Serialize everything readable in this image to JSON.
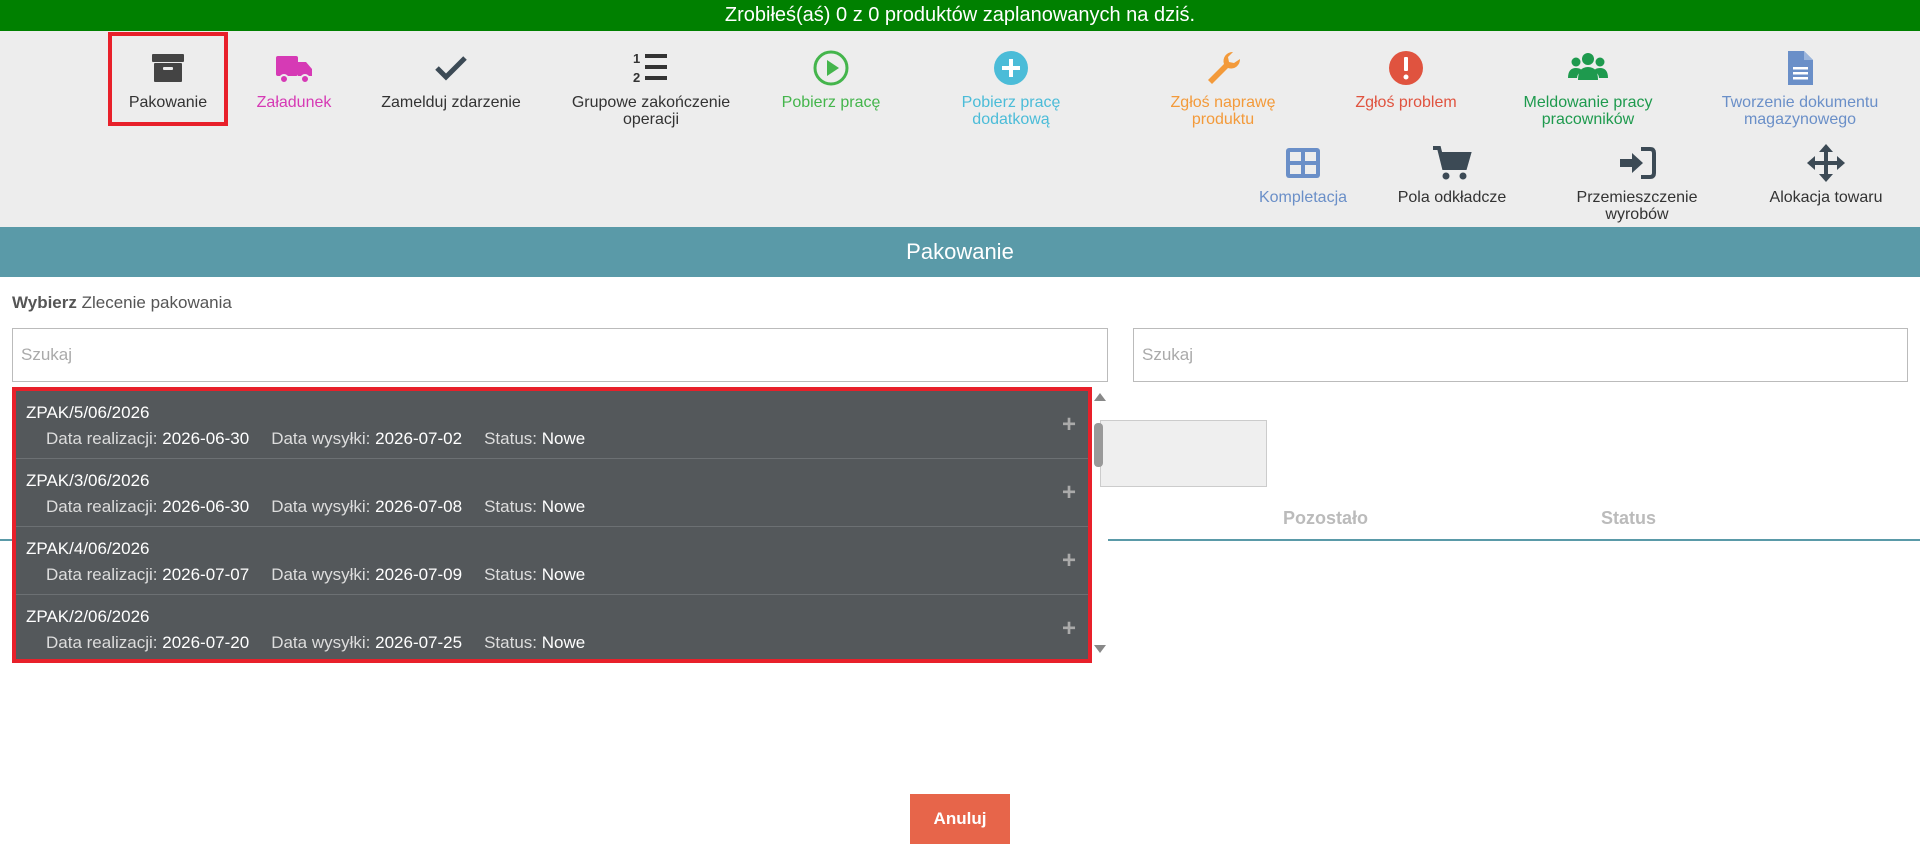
{
  "banner": {
    "text": "Zrobiłeś(aś) 0 z 0 produktów zaplanowanych na dziś."
  },
  "toolbar": {
    "items": [
      {
        "label": "Pakowanie",
        "color": "#333333"
      },
      {
        "label": "Załadunek",
        "color": "#d63ab5"
      },
      {
        "label": "Zamelduj zdarzenie",
        "color": "#333333"
      },
      {
        "label": "Grupowe zakończenie operacji",
        "color": "#333333"
      },
      {
        "label": "Pobierz pracę",
        "color": "#44b54c"
      },
      {
        "label": "Pobierz pracę dodatkową",
        "color": "#4bbcd8"
      },
      {
        "label": "Zgłoś naprawę produktu",
        "color": "#f39a3a"
      },
      {
        "label": "Zgłoś problem",
        "color": "#e0533f"
      },
      {
        "label": "Meldowanie pracy pracowników",
        "color": "#1e9a4e"
      },
      {
        "label": "Tworzenie dokumentu magazynowego",
        "color": "#6a8fc8"
      },
      {
        "label": "Kompletacja",
        "color": "#6a8fc8"
      },
      {
        "label": "Pola odkładcze",
        "color": "#333333"
      },
      {
        "label": "Przemieszczenie wyrobów",
        "color": "#333333"
      },
      {
        "label": "Alokacja towaru",
        "color": "#333333"
      }
    ]
  },
  "section": {
    "title": "Pakowanie"
  },
  "select": {
    "bold": "Wybierz",
    "rest": "Zlecenie pakowania"
  },
  "search_left": {
    "placeholder": "Szukaj",
    "value": ""
  },
  "search_right": {
    "placeholder": "Szukaj",
    "value": ""
  },
  "table": {
    "col_remaining": "Pozostało",
    "col_status": "Status"
  },
  "dropdown": {
    "realization_label": "Data realizacji:",
    "shipping_label": "Data wysyłki:",
    "status_label": "Status:",
    "items": [
      {
        "code": "ZPAK/5/06/2026",
        "realization": "2026-06-30",
        "shipping": "2026-07-02",
        "status": "Nowe"
      },
      {
        "code": "ZPAK/3/06/2026",
        "realization": "2026-06-30",
        "shipping": "2026-07-08",
        "status": "Nowe"
      },
      {
        "code": "ZPAK/4/06/2026",
        "realization": "2026-07-07",
        "shipping": "2026-07-09",
        "status": "Nowe"
      },
      {
        "code": "ZPAK/2/06/2026",
        "realization": "2026-07-20",
        "shipping": "2026-07-25",
        "status": "Nowe"
      }
    ]
  },
  "cancel": {
    "label": "Anuluj"
  }
}
